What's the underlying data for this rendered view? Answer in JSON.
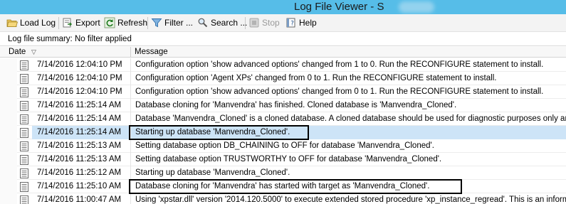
{
  "window": {
    "title": "Log File Viewer - S"
  },
  "toolbar": {
    "load_log": "Load Log",
    "export": "Export",
    "refresh": "Refresh",
    "filter": "Filter ...",
    "search": "Search ...",
    "stop": "Stop",
    "help": "Help"
  },
  "summary": "Log file summary: No filter applied",
  "columns": {
    "date": "Date",
    "message": "Message"
  },
  "rows": [
    {
      "date": "7/14/2016 12:04:10 PM",
      "message": "Configuration option 'show advanced options' changed from 1 to 0. Run the RECONFIGURE statement to install."
    },
    {
      "date": "7/14/2016 12:04:10 PM",
      "message": "Configuration option 'Agent XPs' changed from 0 to 1. Run the RECONFIGURE statement to install."
    },
    {
      "date": "7/14/2016 12:04:10 PM",
      "message": "Configuration option 'show advanced options' changed from 0 to 1. Run the RECONFIGURE statement to install."
    },
    {
      "date": "7/14/2016 11:25:14 AM",
      "message": "Database cloning for 'Manvendra' has finished. Cloned database is 'Manvendra_Cloned'."
    },
    {
      "date": "7/14/2016 11:25:14 AM",
      "message": "Database 'Manvendra_Cloned' is a cloned database. A cloned database should be used for diagnostic purposes only and is not s"
    },
    {
      "date": "7/14/2016 11:25:14 AM",
      "message": "Starting up database 'Manvendra_Cloned'."
    },
    {
      "date": "7/14/2016 11:25:13 AM",
      "message": "Setting database option DB_CHAINING to OFF for database 'Manvendra_Cloned'."
    },
    {
      "date": "7/14/2016 11:25:13 AM",
      "message": "Setting database option TRUSTWORTHY to OFF for database 'Manvendra_Cloned'."
    },
    {
      "date": "7/14/2016 11:25:12 AM",
      "message": "Starting up database 'Manvendra_Cloned'."
    },
    {
      "date": "7/14/2016 11:25:10 AM",
      "message": "Database cloning for 'Manvendra' has started with target as 'Manvendra_Cloned'."
    },
    {
      "date": "7/14/2016 11:00:47 AM",
      "message": "Using 'xpstar.dll' version '2014.120.5000' to execute extended stored procedure 'xp_instance_regread'. This is an informational me"
    }
  ],
  "selected_row_index": 5,
  "colors": {
    "titlebar": "#56bde8",
    "selection": "#cde4f7"
  }
}
